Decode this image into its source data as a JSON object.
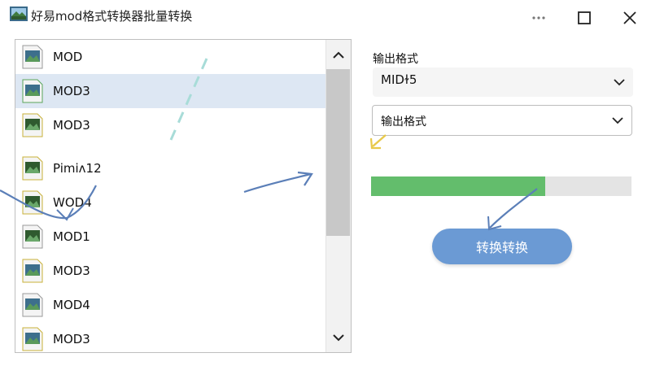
{
  "window": {
    "title": "好易mod格式转换器批量转换"
  },
  "file_list": {
    "items": [
      {
        "label": "MOD",
        "icon": "image-file-icon",
        "selected": false
      },
      {
        "label": "MOD3",
        "icon": "image-file-icon",
        "selected": true
      },
      {
        "label": "MOD3",
        "icon": "image-file-icon",
        "selected": false
      },
      {
        "label": "Pimiʌ12",
        "icon": "image-file-icon",
        "selected": false
      },
      {
        "label": "WOD4",
        "icon": "image-file-icon",
        "selected": false
      },
      {
        "label": "MOD1",
        "icon": "image-file-icon",
        "selected": false
      },
      {
        "label": "MOD3",
        "icon": "image-file-icon",
        "selected": false
      },
      {
        "label": "MOD4",
        "icon": "image-file-icon",
        "selected": false
      },
      {
        "label": "MOD3",
        "icon": "image-file-icon",
        "selected": false
      }
    ]
  },
  "output": {
    "label": "输出格式",
    "format_select": {
      "value": "MIDɫ5"
    },
    "format_select_2": {
      "value": "输出格式"
    }
  },
  "progress": {
    "value": 0.67,
    "color": "#63bd6c"
  },
  "convert_button": {
    "label": "转换转换",
    "color": "#6b9ad4"
  }
}
